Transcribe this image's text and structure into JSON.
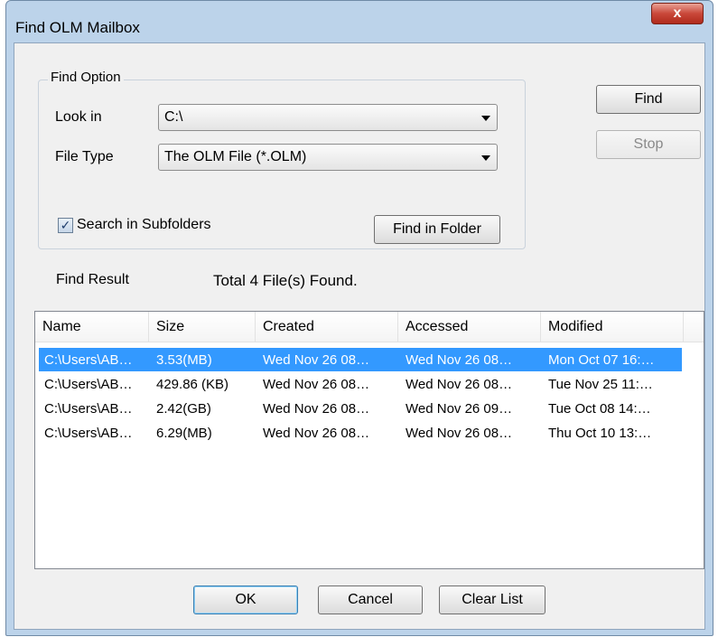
{
  "window": {
    "title": "Find OLM Mailbox",
    "close_label": "x"
  },
  "find_option": {
    "legend": "Find Option",
    "look_in_label": "Look in",
    "look_in_value": "C:\\",
    "file_type_label": "File Type",
    "file_type_value": "The OLM File (*.OLM)",
    "search_subfolders_label": "Search in Subfolders",
    "search_subfolders_checked": true,
    "find_in_folder_label": "Find in Folder"
  },
  "side_buttons": {
    "find_label": "Find",
    "stop_label": "Stop"
  },
  "result": {
    "label": "Find Result",
    "summary": "Total 4 File(s) Found."
  },
  "table": {
    "columns": [
      "Name",
      "Size",
      "Created",
      "Accessed",
      "Modified"
    ],
    "rows": [
      [
        "C:\\Users\\AB…",
        "3.53(MB)",
        "Wed Nov 26 08…",
        "Wed Nov 26 08…",
        "Mon Oct 07 16:…"
      ],
      [
        "C:\\Users\\AB…",
        "429.86 (KB)",
        "Wed Nov 26 08…",
        "Wed Nov 26 08…",
        "Tue Nov 25 11:…"
      ],
      [
        "C:\\Users\\AB…",
        "2.42(GB)",
        "Wed Nov 26 08…",
        "Wed Nov 26 09…",
        "Tue Oct 08 14:…"
      ],
      [
        "C:\\Users\\AB…",
        "6.29(MB)",
        "Wed Nov 26 08…",
        "Wed Nov 26 08…",
        "Thu Oct 10 13:…"
      ]
    ],
    "selected_row": 0
  },
  "bottom_buttons": {
    "ok_label": "OK",
    "cancel_label": "Cancel",
    "clear_label": "Clear List"
  },
  "colors": {
    "selection": "#3399ff",
    "frame": "#bcd3ea"
  }
}
